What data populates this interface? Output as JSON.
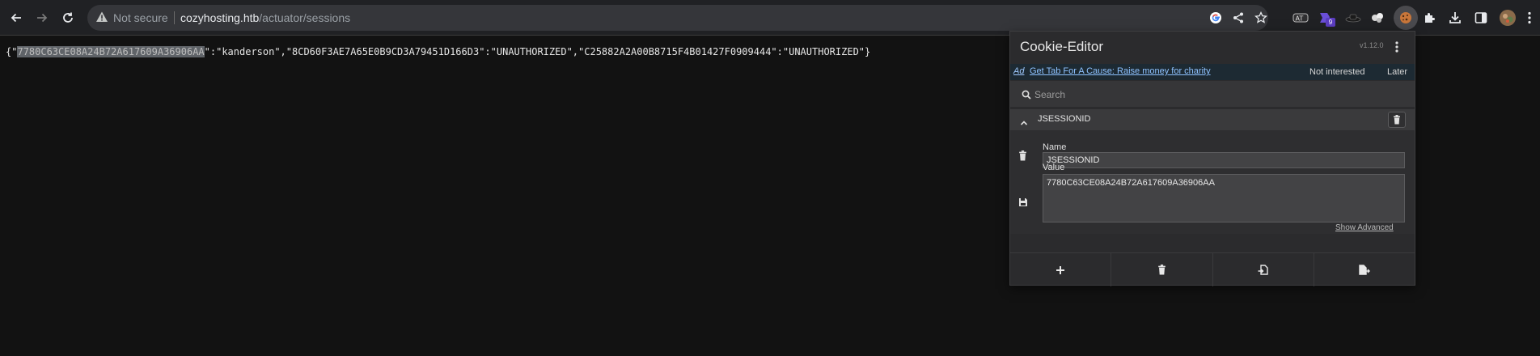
{
  "browser": {
    "security_label": "Not secure",
    "url_host": "cozyhosting.htb",
    "url_path": "/actuator/sessions",
    "extension_badge": "9"
  },
  "page": {
    "json_prefix": "{\"",
    "highlighted_session": "7780C63CE08A24B72A617609A36906AA",
    "json_rest": "\":\"kanderson\",\"8CD60F3AE7A65E0B9CD3A79451D166D3\":\"UNAUTHORIZED\",\"C25882A2A00B8715F4B01427F0909444\":\"UNAUTHORIZED\"}"
  },
  "cookie_editor": {
    "title": "Cookie-Editor",
    "version": "v1.12.0",
    "ad": {
      "tag": "Ad",
      "link": "Get Tab For A Cause: Raise money for charity",
      "not_interested": "Not interested",
      "later": "Later"
    },
    "search_placeholder": "Search",
    "cookie": {
      "header_name": "JSESSIONID",
      "name_label": "Name",
      "name_value": "JSESSIONID",
      "value_label": "Value",
      "value": "7780C63CE08A24B72A617609A36906AA",
      "show_advanced": "Show Advanced"
    }
  },
  "colors": {
    "toolbar_bg": "#202124",
    "page_bg": "#121212",
    "popup_bg": "#2b2b2d",
    "ad_link": "#8ec2ff"
  },
  "icons": [
    "back-arrow-icon",
    "forward-arrow-icon",
    "reload-icon",
    "warning-triangle-icon",
    "google-icon",
    "share-icon",
    "star-icon",
    "extensions-puzzle-icon",
    "download-icon",
    "side-panel-icon",
    "avatar",
    "chrome-menu-icon",
    "search-icon",
    "chevron-up-icon",
    "trash-icon",
    "save-icon",
    "plus-icon",
    "import-icon",
    "export-icon"
  ]
}
